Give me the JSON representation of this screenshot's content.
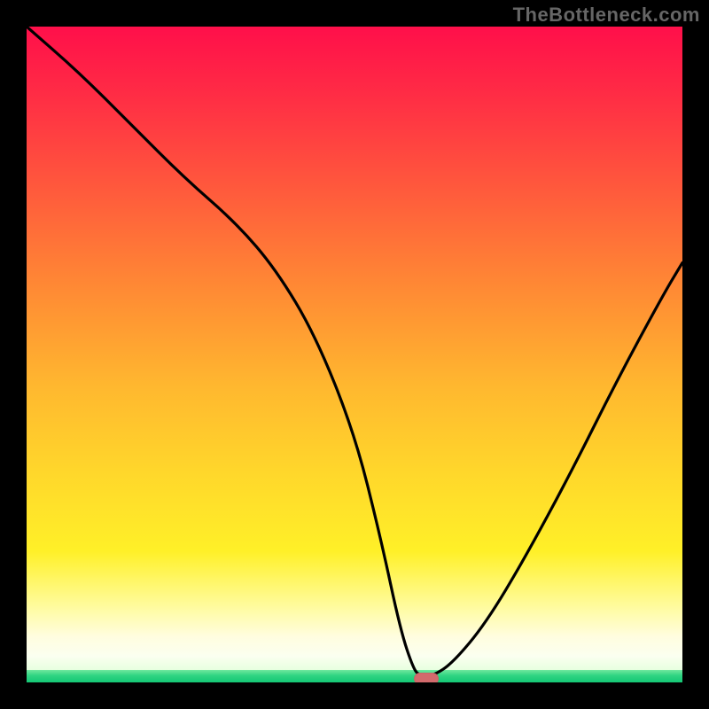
{
  "watermark": "TheBottleneck.com",
  "chart_data": {
    "type": "line",
    "title": "",
    "xlabel": "",
    "ylabel": "",
    "xlim": [
      0,
      100
    ],
    "ylim": [
      0,
      100
    ],
    "grid": false,
    "legend": false,
    "series": [
      {
        "name": "curve",
        "x": [
          0,
          8,
          16,
          24,
          32,
          38,
          44,
          50,
          54,
          57,
          59,
          60,
          62,
          65,
          70,
          76,
          83,
          90,
          97,
          100
        ],
        "y": [
          100,
          93,
          85,
          77,
          70,
          63,
          53,
          38,
          22,
          8,
          2,
          1,
          1,
          3,
          9,
          19,
          32,
          46,
          59,
          64
        ]
      }
    ],
    "marker": {
      "x": 61,
      "y": 0.5,
      "color": "#d26a6c"
    },
    "background_gradient": {
      "top": "#ff0f4a",
      "mid": "#ffd72b",
      "bottom": "#14c775"
    }
  },
  "marker_color": "#d26a6c"
}
